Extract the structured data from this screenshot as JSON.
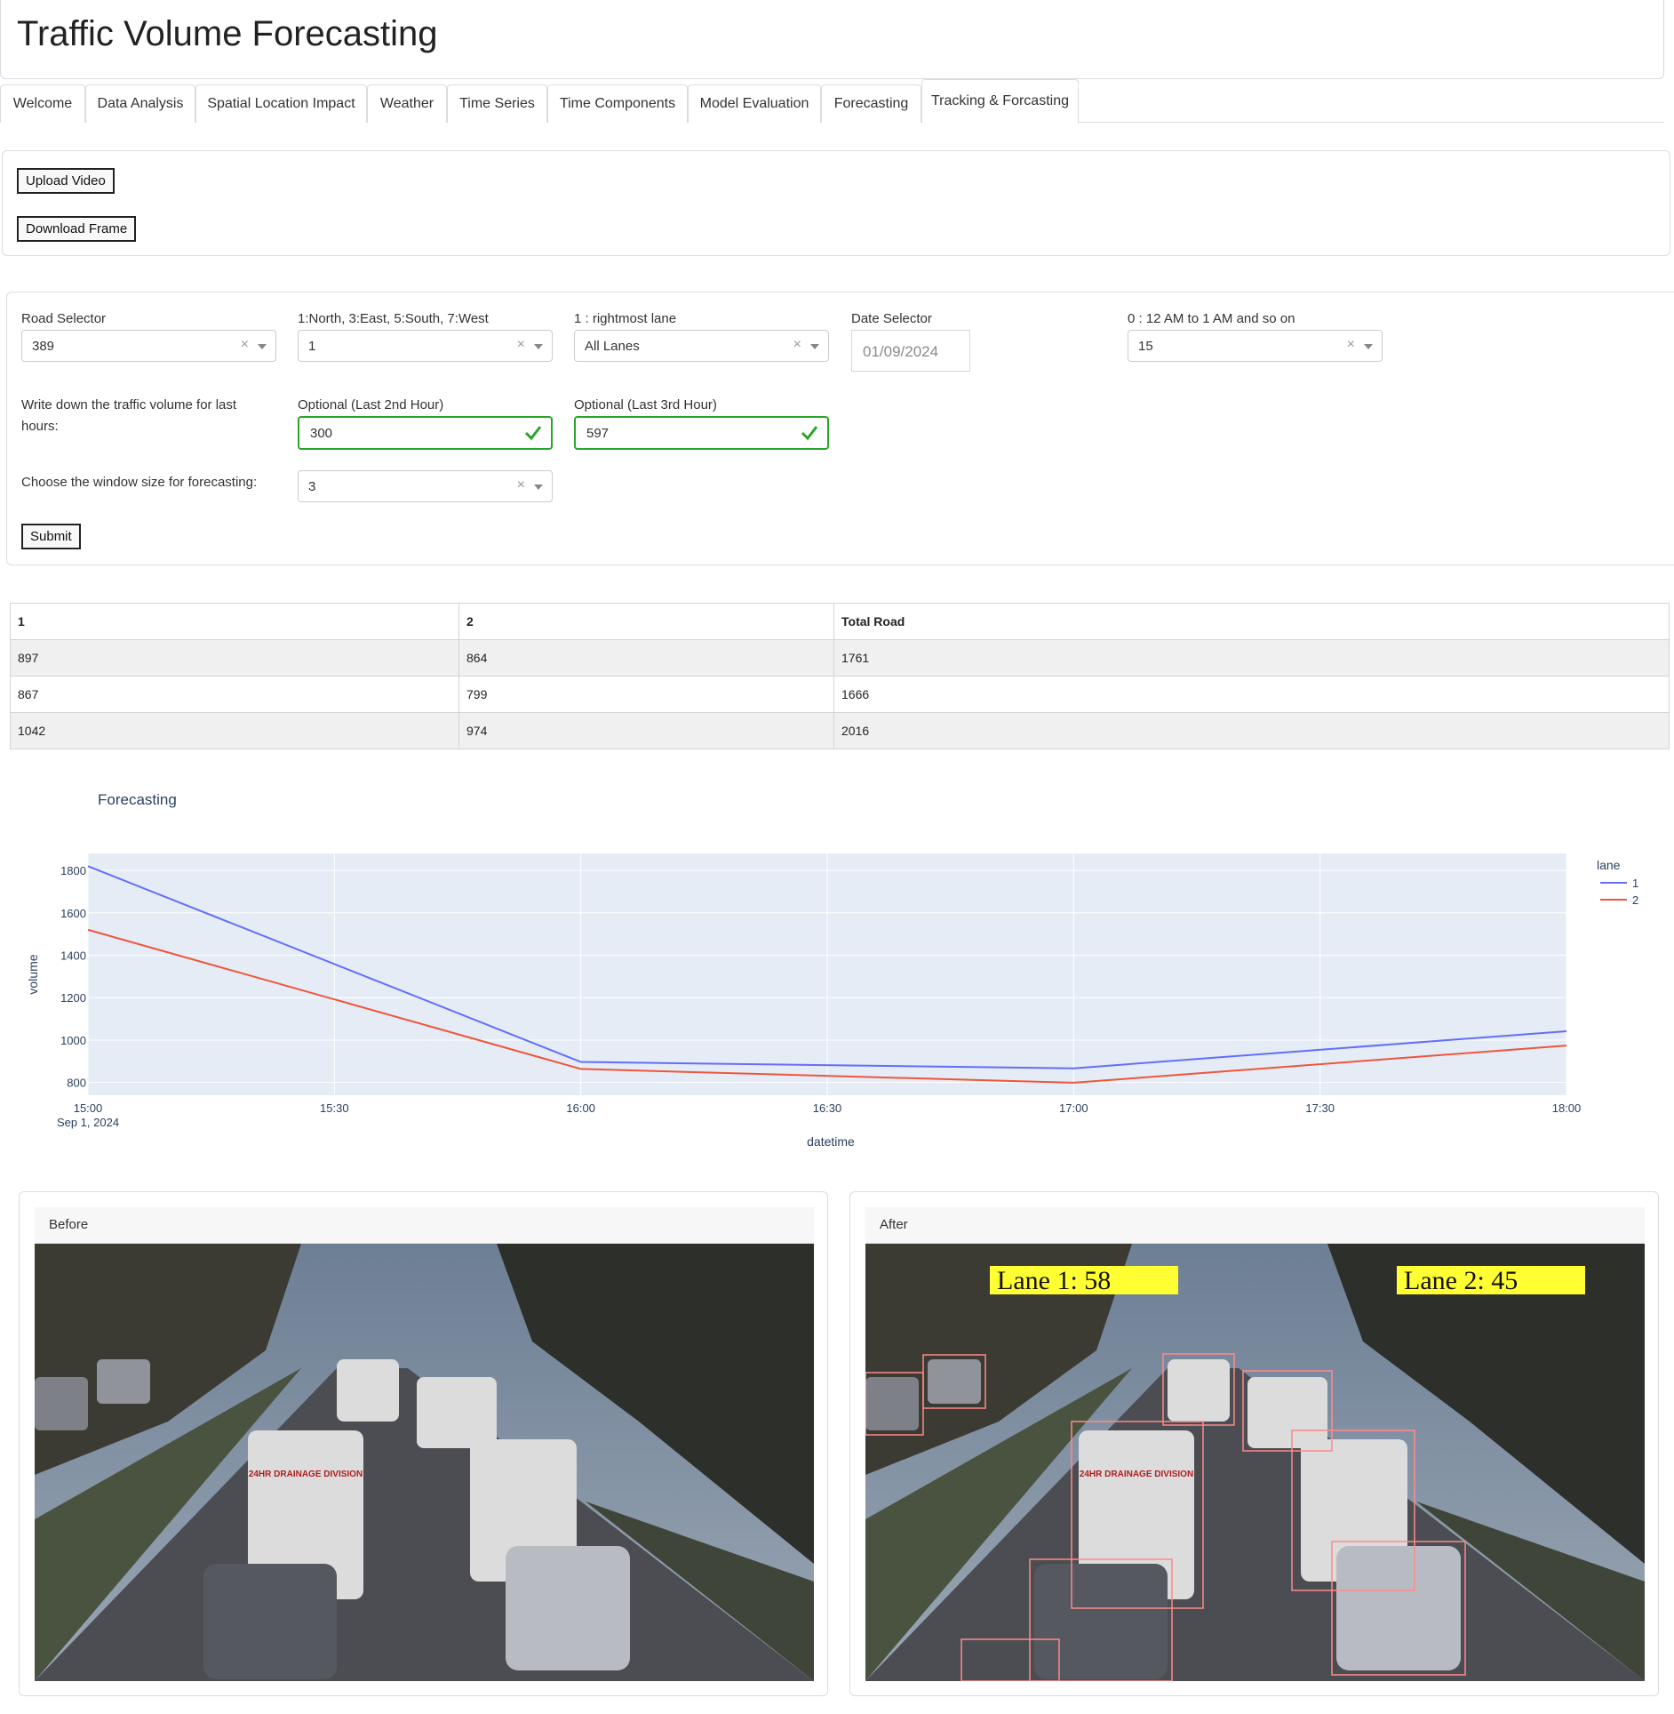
{
  "app": {
    "title": "Traffic Volume Forecasting"
  },
  "tabs": [
    {
      "label": "Welcome"
    },
    {
      "label": "Data Analysis"
    },
    {
      "label": "Spatial Location Impact"
    },
    {
      "label": "Weather"
    },
    {
      "label": "Time Series"
    },
    {
      "label": "Time Components"
    },
    {
      "label": "Model Evaluation"
    },
    {
      "label": "Forecasting"
    },
    {
      "label": "Tracking & Forcasting"
    }
  ],
  "upload": {
    "upload_label": "Upload Video",
    "download_label": "Download Frame"
  },
  "form": {
    "road": {
      "label": "Road Selector",
      "value": "389"
    },
    "direction": {
      "label": "1:North, 3:East, 5:South, 7:West",
      "value": "1"
    },
    "lane": {
      "label": "1 : rightmost lane",
      "value": "All Lanes"
    },
    "date": {
      "label": "Date Selector",
      "value": "01/09/2024"
    },
    "hour": {
      "label": "0 : 12 AM to 1 AM and so on",
      "value": "15"
    },
    "volume_label": "Write down the traffic volume for last hours:",
    "last2": {
      "label": "Optional (Last 2nd Hour)",
      "value": "300"
    },
    "last3": {
      "label": "Optional (Last 3rd Hour)",
      "value": "597"
    },
    "window": {
      "label": "Choose the window size for forecasting:",
      "value": "3"
    },
    "submit_label": "Submit"
  },
  "table": {
    "headers": [
      "1",
      "2",
      "Total Road"
    ],
    "rows": [
      [
        "897",
        "864",
        "1761"
      ],
      [
        "867",
        "799",
        "1666"
      ],
      [
        "1042",
        "974",
        "2016"
      ]
    ]
  },
  "chart_data": {
    "type": "line",
    "title": "Forecasting",
    "xlabel": "datetime",
    "ylabel": "volume",
    "legend_title": "lane",
    "legend_position": "top-right",
    "x": [
      "2024-09-01 15:00",
      "2024-09-01 16:00",
      "2024-09-01 17:00",
      "2024-09-01 18:00"
    ],
    "x_ticks": [
      "15:00",
      "15:30",
      "16:00",
      "16:30",
      "17:00",
      "17:30",
      "18:00"
    ],
    "x_tick_sub": "Sep 1, 2024",
    "y_ticks": [
      "800",
      "1000",
      "1200",
      "1400",
      "1600",
      "1800"
    ],
    "ylim": [
      740,
      1880
    ],
    "grid": true,
    "series": [
      {
        "name": "1",
        "color": "#636efa",
        "values": [
          1820,
          897,
          867,
          1042
        ]
      },
      {
        "name": "2",
        "color": "#ef553b",
        "values": [
          1520,
          864,
          799,
          974
        ]
      }
    ]
  },
  "images": {
    "before_label": "Before",
    "after_label": "After",
    "lane1_text": "Lane 1: 58",
    "lane2_text": "Lane 2: 45",
    "van_text": "24HR DRAINAGE DIVISION"
  },
  "colors": {
    "success": "#2aa52a",
    "highlight": "#ffff33",
    "box": "#ff6b6b"
  }
}
